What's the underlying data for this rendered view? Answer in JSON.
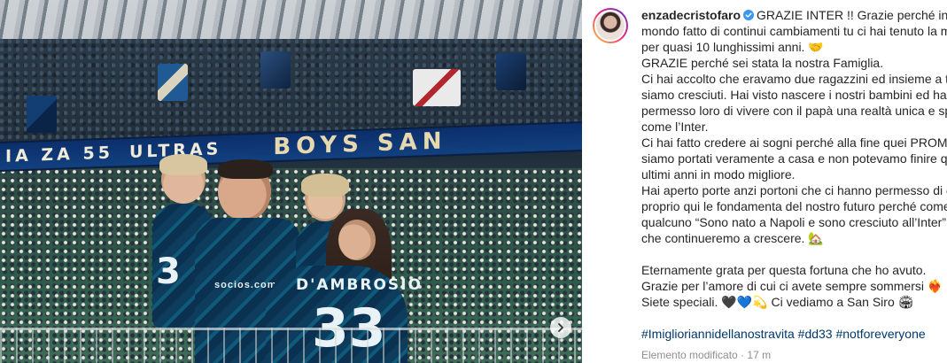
{
  "post": {
    "author": "enzadecristofaro",
    "verified": true,
    "caption_lines": [
      "GRAZIE INTER !! Grazie perché in un",
      "mondo fatto di continui cambiamenti tu ci hai tenuto la mano",
      "per quasi 10 lunghissimi anni. 🤝",
      "GRAZIE perché sei stata la nostra Famiglia.",
      "Ci hai accolto che eravamo due ragazzini ed insieme a te",
      "siamo cresciuti. Hai visto nascere i nostri bambini ed hai",
      "permesso loro di vivere con il papà una realtà unica e speciale",
      "come l’Inter.",
      "Ci hai fatto credere ai sogni perché alla fine quei PROMESSI",
      "siamo portati veramente a casa e non potevamo finire questi",
      "ultimi anni in modo migliore.",
      "Hai aperto porte anzi portoni che ci hanno permesso di creare",
      "proprio qui le fondamenta del nostro futuro perché come dice",
      "qualcuno “Sono nato a Napoli e sono cresciuto all’Inter” e qui",
      "che continueremo a crescere. 🏡",
      "",
      "Eternamente grata per questa fortuna che ho avuto.",
      "Grazie per l’amore di cui ci avete sempre sommersi ❤️‍🔥",
      "Siete speciali. 🖤💙💫 Ci vediamo a San Siro 🏟"
    ],
    "hashtags": [
      "#Imiglioriannidellanostravita",
      "#dd33",
      "#notforeveryone"
    ],
    "edited_label": "Elemento modificato",
    "separator": "·",
    "time_ago": "17 m"
  },
  "media": {
    "banner_text_small": "IA ZA 55",
    "banner_text_small_2": "ULTRAS",
    "banner_text_main": "BOYS SAN",
    "jersey_name": "D'AMBROSIO",
    "jersey_number": "33",
    "child_number": "3",
    "sponsor": "socios.com",
    "next_icon": "chevron-right-icon"
  },
  "colors": {
    "username": "#262626",
    "hashtag": "#00376b",
    "meta": "#8e8e8e",
    "verified": "#3897f0",
    "inter_blue": "#0b2f6b"
  }
}
